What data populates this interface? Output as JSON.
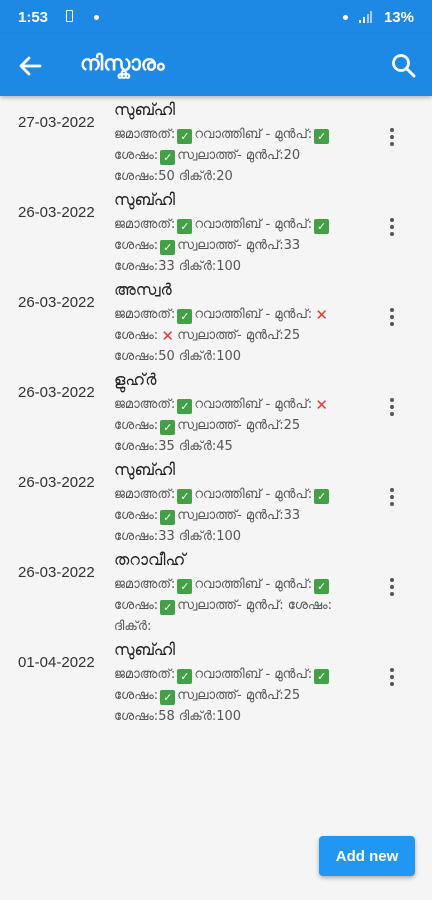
{
  "status": {
    "time": "1:53",
    "battery": "13%"
  },
  "appbar": {
    "title": "നിസ്കാരം"
  },
  "labels": {
    "jamaath": "ജമാഅത്:",
    "ravathib": "റവാത്തിബ് -",
    "munp": "മുൻപ്:",
    "shesham": "ശേഷം:",
    "swalath": "സ്വലാത്ത്-",
    "dhikr": "ദിക്ർ:"
  },
  "icons": {
    "back": "arrow-left-icon",
    "search": "search-icon",
    "menu": "more-vert-icon",
    "yes": "check-mark-icon",
    "no": "cross-mark-icon"
  },
  "entries": [
    {
      "date": "27-03-2022",
      "prayer": "സുബ്ഹി",
      "jamaath": true,
      "rav_before": true,
      "rav_after": true,
      "sw_before": "20",
      "sw_after": "50",
      "dhikr": "20"
    },
    {
      "date": "26-03-2022",
      "prayer": "സുബ്ഹി",
      "jamaath": true,
      "rav_before": true,
      "rav_after": true,
      "sw_before": "33",
      "sw_after": "33",
      "dhikr": "100"
    },
    {
      "date": "26-03-2022",
      "prayer": "അസ്വർ",
      "jamaath": true,
      "rav_before": false,
      "rav_after": false,
      "sw_before": "25",
      "sw_after": "50",
      "dhikr": "100"
    },
    {
      "date": "26-03-2022",
      "prayer": "ളുഹ്ർ",
      "jamaath": true,
      "rav_before": false,
      "rav_after": true,
      "sw_before": "25",
      "sw_after": "35",
      "dhikr": "45"
    },
    {
      "date": "26-03-2022",
      "prayer": "സുബ്ഹി",
      "jamaath": true,
      "rav_before": true,
      "rav_after": true,
      "sw_before": "33",
      "sw_after": "33",
      "dhikr": "100"
    },
    {
      "date": "26-03-2022",
      "prayer": "തറാവീഹ്",
      "jamaath": true,
      "rav_before": true,
      "rav_after": true,
      "sw_before": "",
      "sw_after": "",
      "dhikr": ""
    },
    {
      "date": "01-04-2022",
      "prayer": "സുബ്ഹി",
      "jamaath": true,
      "rav_before": true,
      "rav_after": true,
      "sw_before": "25",
      "sw_after": "58",
      "dhikr": "100"
    }
  ],
  "add_button": "Add new",
  "colors": {
    "primary": "#1e88e5",
    "check": "#43a047",
    "cross": "#e53935"
  }
}
